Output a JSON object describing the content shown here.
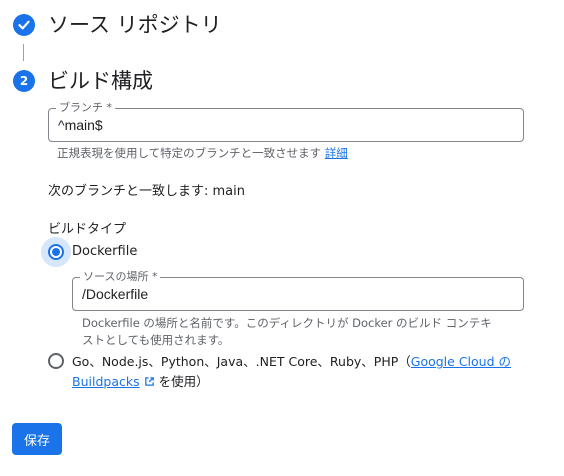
{
  "steps": [
    {
      "title": "ソース リポジトリ",
      "state": "complete",
      "icon": "check-icon"
    },
    {
      "number": "2",
      "title": "ビルド構成",
      "state": "active"
    }
  ],
  "branch_field": {
    "label": "ブランチ *",
    "value": "^main$",
    "hint": "正規表現を使用して特定のブランチと一致させます",
    "hint_link": "詳細"
  },
  "match_text": "次のブランチと一致します: main",
  "build_type": {
    "label": "ビルドタイプ",
    "options": [
      {
        "label": "Dockerfile",
        "selected": true
      },
      {
        "label_prefix": "Go、Node.js、Python、Java、.NET Core、Ruby、PHP（",
        "link_line1": "Google Cloud の",
        "link_line2": "Buildpacks",
        "link_icon": "external-link-icon",
        "label_suffix": " を使用）",
        "selected": false
      }
    ]
  },
  "source_location_field": {
    "label": "ソースの場所 *",
    "value": "/Dockerfile",
    "hint_line1": "Dockerfile の場所と名前です。このディレクトリが Docker のビルド コンテキ",
    "hint_line2": "ストとしても使用されます。"
  },
  "save_button": {
    "label": "保存"
  },
  "colors": {
    "accent": "#1a73e8",
    "border": "#80868b",
    "muted": "#5f6368"
  }
}
